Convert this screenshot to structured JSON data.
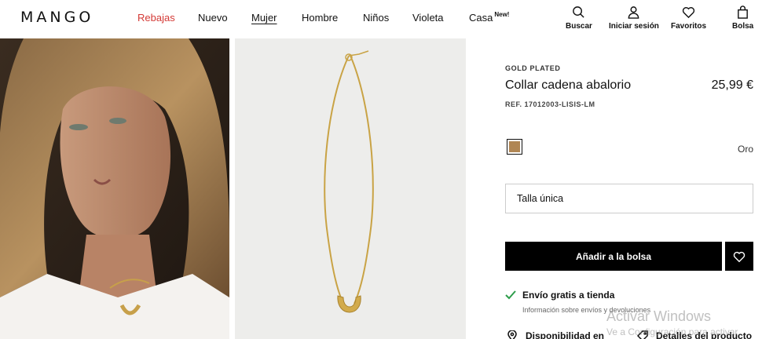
{
  "header": {
    "logo": "MANGO",
    "nav": [
      {
        "label": "Rebajas",
        "name": "nav-rebajas"
      },
      {
        "label": "Nuevo",
        "name": "nav-nuevo"
      },
      {
        "label": "Mujer",
        "name": "nav-mujer"
      },
      {
        "label": "Hombre",
        "name": "nav-hombre"
      },
      {
        "label": "Niños",
        "name": "nav-ninos"
      },
      {
        "label": "Violeta",
        "name": "nav-violeta"
      },
      {
        "label": "Casa",
        "name": "nav-casa",
        "badge": "New!"
      }
    ],
    "actions": [
      {
        "label": "Buscar",
        "icon": "search-icon"
      },
      {
        "label": "Iniciar sesión",
        "icon": "user-icon"
      },
      {
        "label": "Favoritos",
        "icon": "heart-icon"
      },
      {
        "label": "Bolsa",
        "icon": "bag-icon"
      }
    ]
  },
  "product": {
    "brand_line": "GOLD PLATED",
    "name": "Collar cadena abalorio",
    "price": "25,99 €",
    "ref": "REF. 17012003-LISIS-LM",
    "color_name": "Oro",
    "color_hex": "#b08654",
    "size_label": "Talla única",
    "add_button": "Añadir a la bolsa",
    "shipping_title": "Envío gratis a tienda",
    "shipping_sub": "Información sobre envíos y devoluciones",
    "availability": "Disponibilidad en",
    "details": "Detalles del producto"
  },
  "watermark": {
    "title": "Activar Windows",
    "subtitle": "Ve a Configuración para activar"
  },
  "colors": {
    "sale": "#d43a36",
    "shipping_check": "#2e9d4b",
    "button": "#000000"
  }
}
